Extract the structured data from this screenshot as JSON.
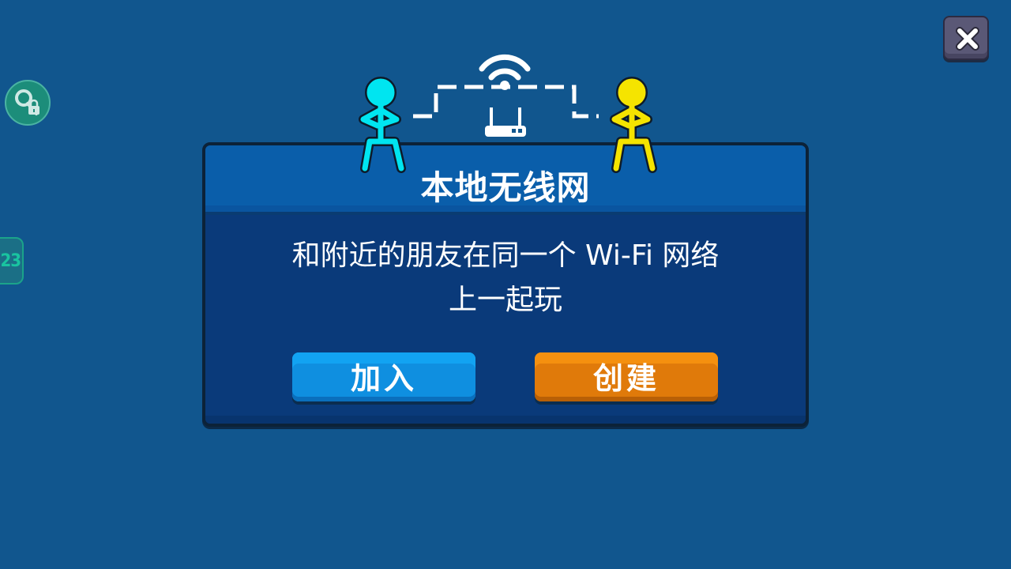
{
  "dialog": {
    "title": "本地无线网",
    "message_line1": "和附近的朋友在同一个 Wi-Fi 网络",
    "message_line2": "上一起玩",
    "join_label": "加入",
    "create_label": "创建"
  },
  "side": {
    "code_text": "23"
  },
  "icons": {
    "close": "close-icon",
    "key_lock": "key-lock-icon",
    "wifi": "wifi-icon",
    "router": "router-icon"
  },
  "colors": {
    "background": "#11568e",
    "player1": "#00e5f0",
    "player2": "#f5e400",
    "join_button": "#0f8fe0",
    "create_button": "#e07a0a"
  }
}
